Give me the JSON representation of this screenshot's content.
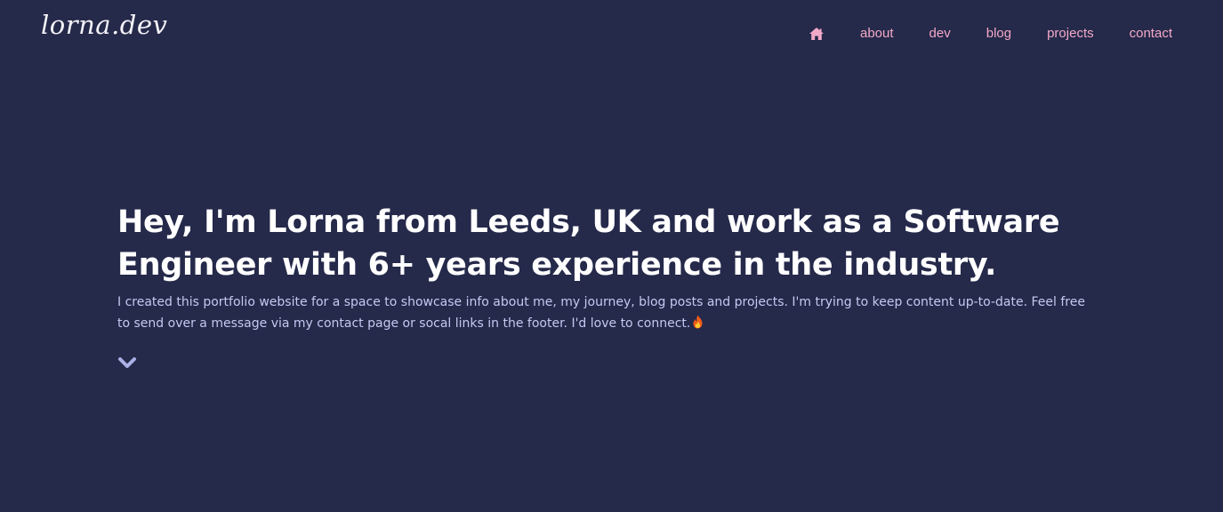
{
  "header": {
    "logo_text": "lorna.dev",
    "nav": {
      "home_icon": "home-icon",
      "items": [
        {
          "label": "about"
        },
        {
          "label": "dev"
        },
        {
          "label": "blog"
        },
        {
          "label": "projects"
        },
        {
          "label": "contact"
        }
      ]
    }
  },
  "hero": {
    "headline": "Hey, I'm Lorna from Leeds, UK and work as a Software Engineer with 6+ years experience in the industry.",
    "intro": "I created this portfolio website for a space to showcase info about me, my journey, blog posts and projects. I'm trying to keep content up-to-date. Feel free to send over a message via my contact page or socal links in the footer. I'd love to connect.",
    "intro_emoji_icon": "fire-icon",
    "scroll_icon": "chevron-down-icon"
  },
  "colors": {
    "background": "#25294a",
    "nav_link": "#f2a9c7",
    "headline": "#ffffff",
    "body_text": "#c4c9f2",
    "chevron": "#aab1e6"
  }
}
